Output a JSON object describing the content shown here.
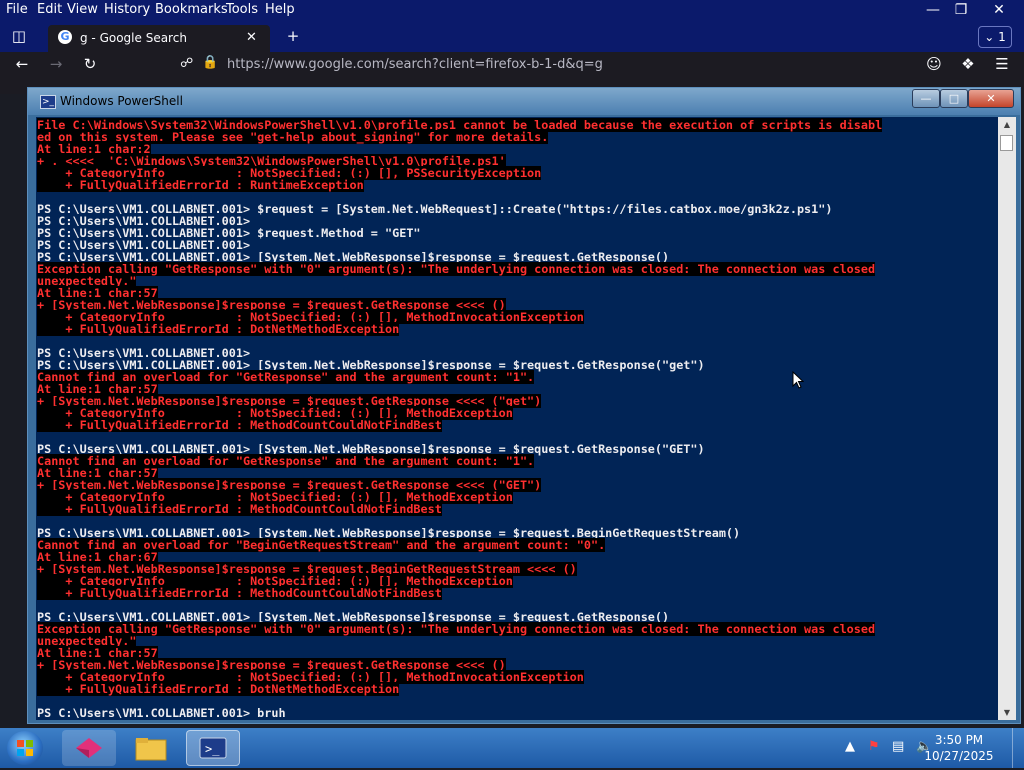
{
  "browser": {
    "menu": [
      "File",
      "Edit",
      "View",
      "History",
      "Bookmarks",
      "Tools",
      "Help"
    ],
    "tab_title": "g - Google Search",
    "tab_count": "1",
    "url": "https://www.google.com/search?client=firefox-b-1-d&q=g"
  },
  "powershell": {
    "title": "Windows PowerShell",
    "lines": [
      {
        "t": "File C:\\Windows\\System32\\WindowsPowerShell\\v1.0\\profile.ps1 cannot be loaded because the execution of scripts is disabl",
        "e": true
      },
      {
        "t": "ed on this system. Please see \"get-help about_signing\" for more details.",
        "e": true
      },
      {
        "t": "At line:1 char:2",
        "e": true
      },
      {
        "t": "+ . <<<<  'C:\\Windows\\System32\\WindowsPowerShell\\v1.0\\profile.ps1'",
        "e": true
      },
      {
        "t": "    + CategoryInfo          : NotSpecified: (:) [], PSSecurityException",
        "e": true
      },
      {
        "t": "    + FullyQualifiedErrorId : RuntimeException",
        "e": true
      },
      {
        "t": "",
        "e": false
      },
      {
        "t": "PS C:\\Users\\VM1.COLLABNET.001> $request = [System.Net.WebRequest]::Create(\"https://files.catbox.moe/gn3k2z.ps1\")",
        "e": false
      },
      {
        "t": "PS C:\\Users\\VM1.COLLABNET.001>",
        "e": false
      },
      {
        "t": "PS C:\\Users\\VM1.COLLABNET.001> $request.Method = \"GET\"",
        "e": false
      },
      {
        "t": "PS C:\\Users\\VM1.COLLABNET.001>",
        "e": false
      },
      {
        "t": "PS C:\\Users\\VM1.COLLABNET.001> [System.Net.WebResponse]$response = $request.GetResponse()",
        "e": false
      },
      {
        "t": "Exception calling \"GetResponse\" with \"0\" argument(s): \"The underlying connection was closed: The connection was closed",
        "e": true
      },
      {
        "t": "unexpectedly.\"",
        "e": true
      },
      {
        "t": "At line:1 char:57",
        "e": true
      },
      {
        "t": "+ [System.Net.WebResponse]$response = $request.GetResponse <<<< ()",
        "e": true
      },
      {
        "t": "    + CategoryInfo          : NotSpecified: (:) [], MethodInvocationException",
        "e": true
      },
      {
        "t": "    + FullyQualifiedErrorId : DotNetMethodException",
        "e": true
      },
      {
        "t": "",
        "e": false
      },
      {
        "t": "PS C:\\Users\\VM1.COLLABNET.001>",
        "e": false
      },
      {
        "t": "PS C:\\Users\\VM1.COLLABNET.001> [System.Net.WebResponse]$response = $request.GetResponse(\"get\")",
        "e": false
      },
      {
        "t": "Cannot find an overload for \"GetResponse\" and the argument count: \"1\".",
        "e": true
      },
      {
        "t": "At line:1 char:57",
        "e": true
      },
      {
        "t": "+ [System.Net.WebResponse]$response = $request.GetResponse <<<< (\"get\")",
        "e": true
      },
      {
        "t": "    + CategoryInfo          : NotSpecified: (:) [], MethodException",
        "e": true
      },
      {
        "t": "    + FullyQualifiedErrorId : MethodCountCouldNotFindBest",
        "e": true
      },
      {
        "t": "",
        "e": false
      },
      {
        "t": "PS C:\\Users\\VM1.COLLABNET.001> [System.Net.WebResponse]$response = $request.GetResponse(\"GET\")",
        "e": false
      },
      {
        "t": "Cannot find an overload for \"GetResponse\" and the argument count: \"1\".",
        "e": true
      },
      {
        "t": "At line:1 char:57",
        "e": true
      },
      {
        "t": "+ [System.Net.WebResponse]$response = $request.GetResponse <<<< (\"GET\")",
        "e": true
      },
      {
        "t": "    + CategoryInfo          : NotSpecified: (:) [], MethodException",
        "e": true
      },
      {
        "t": "    + FullyQualifiedErrorId : MethodCountCouldNotFindBest",
        "e": true
      },
      {
        "t": "",
        "e": false
      },
      {
        "t": "PS C:\\Users\\VM1.COLLABNET.001> [System.Net.WebResponse]$response = $request.BeginGetRequestStream()",
        "e": false
      },
      {
        "t": "Cannot find an overload for \"BeginGetRequestStream\" and the argument count: \"0\".",
        "e": true
      },
      {
        "t": "At line:1 char:67",
        "e": true
      },
      {
        "t": "+ [System.Net.WebResponse]$response = $request.BeginGetRequestStream <<<< ()",
        "e": true
      },
      {
        "t": "    + CategoryInfo          : NotSpecified: (:) [], MethodException",
        "e": true
      },
      {
        "t": "    + FullyQualifiedErrorId : MethodCountCouldNotFindBest",
        "e": true
      },
      {
        "t": "",
        "e": false
      },
      {
        "t": "PS C:\\Users\\VM1.COLLABNET.001> [System.Net.WebResponse]$response = $request.GetResponse()",
        "e": false
      },
      {
        "t": "Exception calling \"GetResponse\" with \"0\" argument(s): \"The underlying connection was closed: The connection was closed",
        "e": true
      },
      {
        "t": "unexpectedly.\"",
        "e": true
      },
      {
        "t": "At line:1 char:57",
        "e": true
      },
      {
        "t": "+ [System.Net.WebResponse]$response = $request.GetResponse <<<< ()",
        "e": true
      },
      {
        "t": "    + CategoryInfo          : NotSpecified: (:) [], MethodInvocationException",
        "e": true
      },
      {
        "t": "    + FullyQualifiedErrorId : DotNetMethodException",
        "e": true
      },
      {
        "t": "",
        "e": false
      },
      {
        "t": "PS C:\\Users\\VM1.COLLABNET.001> bruh",
        "e": false
      }
    ]
  },
  "taskbar": {
    "time": "3:50 PM",
    "date": "10/27/2025"
  },
  "colors": {
    "console_bg": "#012456",
    "error_fg": "#ff3030",
    "error_bg": "#000000",
    "firefox_menubar": "#0b1a6b"
  }
}
